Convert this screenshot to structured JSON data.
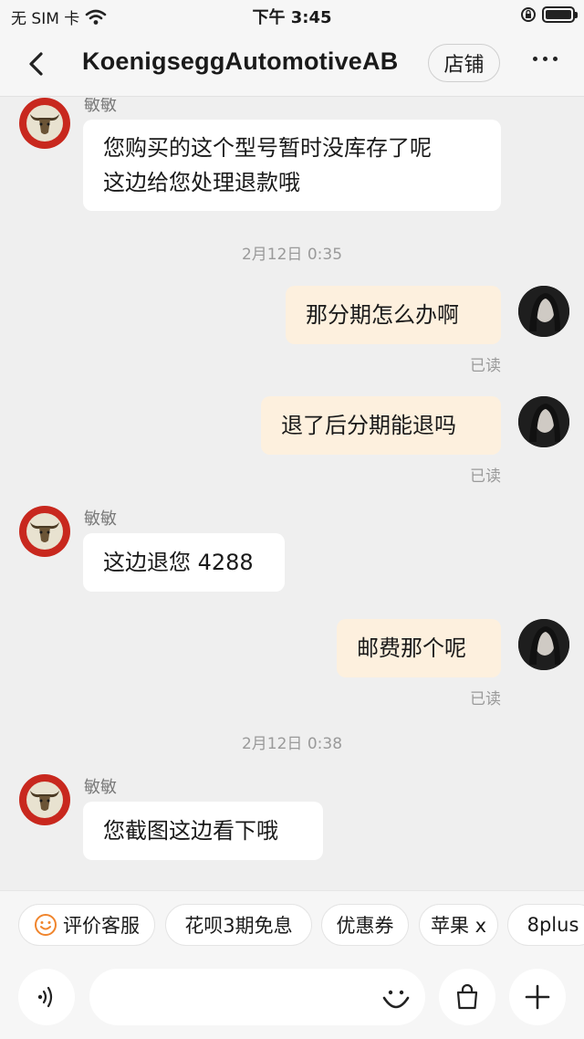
{
  "status_bar": {
    "carrier": "无 SIM 卡",
    "time": "下午 3:45"
  },
  "header": {
    "title": "KoenigseggAutomotiveAB",
    "shop_label": "店铺"
  },
  "messages": [
    {
      "sender": "敏敏",
      "text_line1": "您购买的这个型号暂时没库存了呢",
      "text_line2": "这边给您处理退款哦"
    },
    {
      "timestamp": "2月12日 0:35"
    },
    {
      "text": "那分期怎么办啊",
      "read": "已读"
    },
    {
      "text": "退了后分期能退吗",
      "read": "已读"
    },
    {
      "sender": "敏敏",
      "text": "这边退您 4288"
    },
    {
      "text": "邮费那个呢",
      "read": "已读"
    },
    {
      "timestamp": "2月12日 0:38"
    },
    {
      "sender": "敏敏",
      "text": "您截图这边看下哦"
    }
  ],
  "quick_replies": [
    "评价客服",
    "花呗3期免息",
    "优惠券",
    "苹果 x",
    "8plus"
  ],
  "input": {
    "placeholder": ""
  },
  "colors": {
    "outgoing_bubble": "#fdf0de",
    "incoming_bubble": "#ffffff",
    "background": "#efefef",
    "accent_orange": "#f0852d"
  }
}
